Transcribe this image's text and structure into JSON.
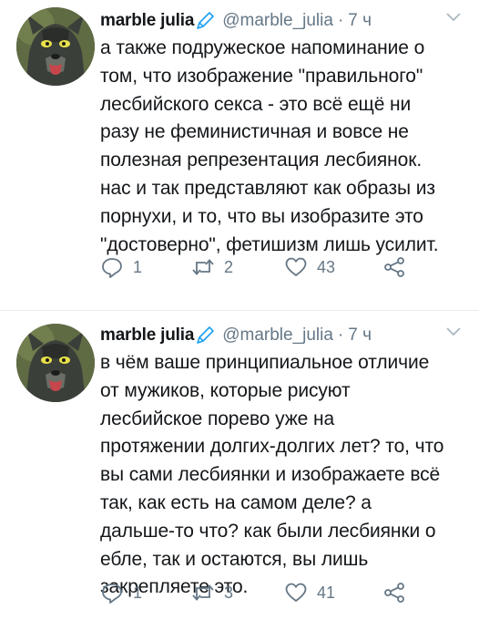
{
  "tweets": [
    {
      "name": "marble julia",
      "handle": "@marble_julia",
      "separator": "·",
      "time": "7 ч",
      "text": "а также подружеское напоминание о\nтом, что изображение \"правильного\"\nлесбийского секса - это всё ещё ни\nразу не феминистичная и вовсе не\nполезная репрезентация лесбиянок.\nнас и так представляют как образы из\nпорнухи, и то, что вы изобразите это\n\"достоверно\", фетишизм лишь усилит.",
      "replies": "1",
      "retweets": "2",
      "likes": "43"
    },
    {
      "name": "marble julia",
      "handle": "@marble_julia",
      "separator": "·",
      "time": "7 ч",
      "text": "в чём ваше принципиальное отличие\nот мужиков, которые рисуют\nлесбийское порево уже на\nпротяжении долгих-долгих лет? то, что\nвы сами лесбиянки и изображаете всё\nтак, как есть на самом деле? а\nдальше-то что? как были лесбиянки о\nебле, так и остаются, вы лишь\nзакрепляете это.",
      "replies": "1",
      "retweets": "3",
      "likes": "41"
    }
  ],
  "icons": {
    "avatar": "cartoon-hyena-avatar",
    "name_decoration": "pencil-icon",
    "menu": "chevron-down-icon",
    "reply": "reply-icon",
    "retweet": "retweet-icon",
    "like": "heart-icon",
    "share": "share-icon"
  },
  "colors": {
    "text": "#14171a",
    "secondary": "#657786",
    "pencil": "#1da1f2",
    "divider": "#e6ecf0"
  }
}
